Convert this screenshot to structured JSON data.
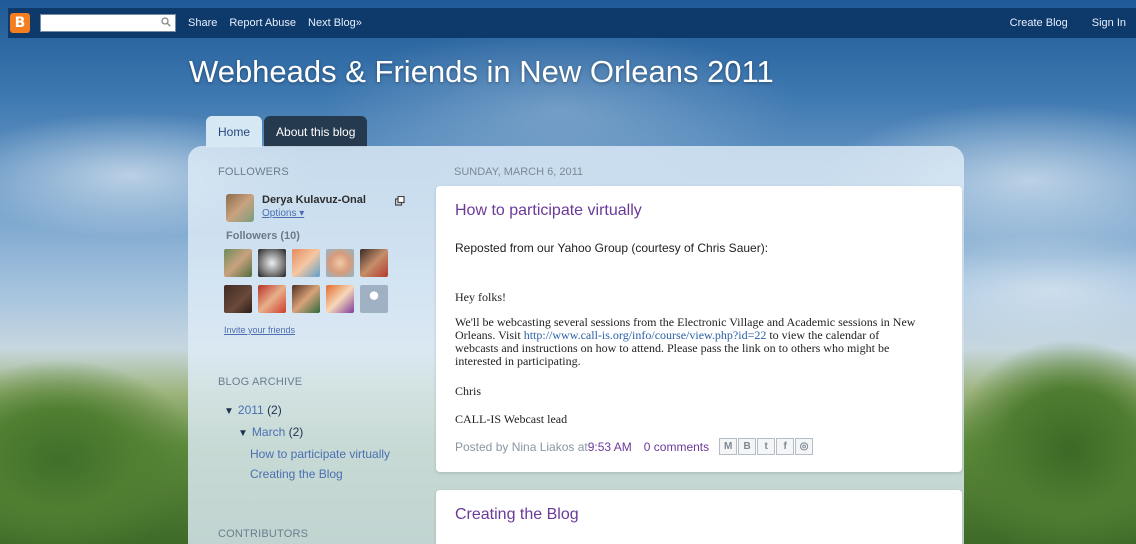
{
  "navbar": {
    "logo_letter": "B",
    "search_value": "",
    "links": [
      "Share",
      "Report Abuse",
      "Next Blog»"
    ],
    "right_links": [
      "Create Blog",
      "Sign In"
    ]
  },
  "blog": {
    "title": "Webheads & Friends in New Orleans 2011",
    "tabs": [
      {
        "label": "Home",
        "active": true
      },
      {
        "label": "About this blog",
        "active": false
      }
    ]
  },
  "sidebar": {
    "followers_heading": "FOLLOWERS",
    "me_name": "Derya Kulavuz-Onal",
    "me_options": "Options ▾",
    "followers_count": "Followers (10)",
    "invite": "Invite your friends",
    "archive_heading": "BLOG ARCHIVE",
    "archive": {
      "year": "2011",
      "year_count": "(2)",
      "month": "March",
      "month_count": "(2)",
      "posts": [
        "How to participate virtually",
        "Creating the Blog"
      ]
    },
    "contributors_heading": "CONTRIBUTORS"
  },
  "main": {
    "date_header": "SUNDAY, MARCH 6, 2011",
    "posts": [
      {
        "title": "How to participate virtually",
        "intro": "Reposted from our Yahoo Group (courtesy of Chris Sauer):",
        "greeting": "Hey folks!",
        "para1": "We'll be webcasting several sessions from the Electronic Village and Academic sessions in New Orleans. Visit ",
        "url": "http://www.call-is.org/info/course/view.php?id=22",
        "para2": " to view the calendar of webcasts and instructions on how to attend. Please pass the link on to others who might be interested in participating.",
        "sign1": "Chris",
        "sign2": "CALL-IS Webcast lead",
        "posted_by": "Posted by Nina Liakos at ",
        "time": "9:53 AM",
        "comments": "0 comments"
      },
      {
        "title": "Creating the Blog"
      }
    ],
    "share_icons": [
      "email-icon",
      "blogger-icon",
      "twitter-icon",
      "facebook-icon",
      "buzz-icon"
    ]
  },
  "colors": {
    "navbar": "#0d3a6b",
    "tab_active": "#d7e8f5",
    "tab_inactive": "#25394f",
    "post_title": "#6b3a99",
    "link": "#4b6fb2"
  }
}
